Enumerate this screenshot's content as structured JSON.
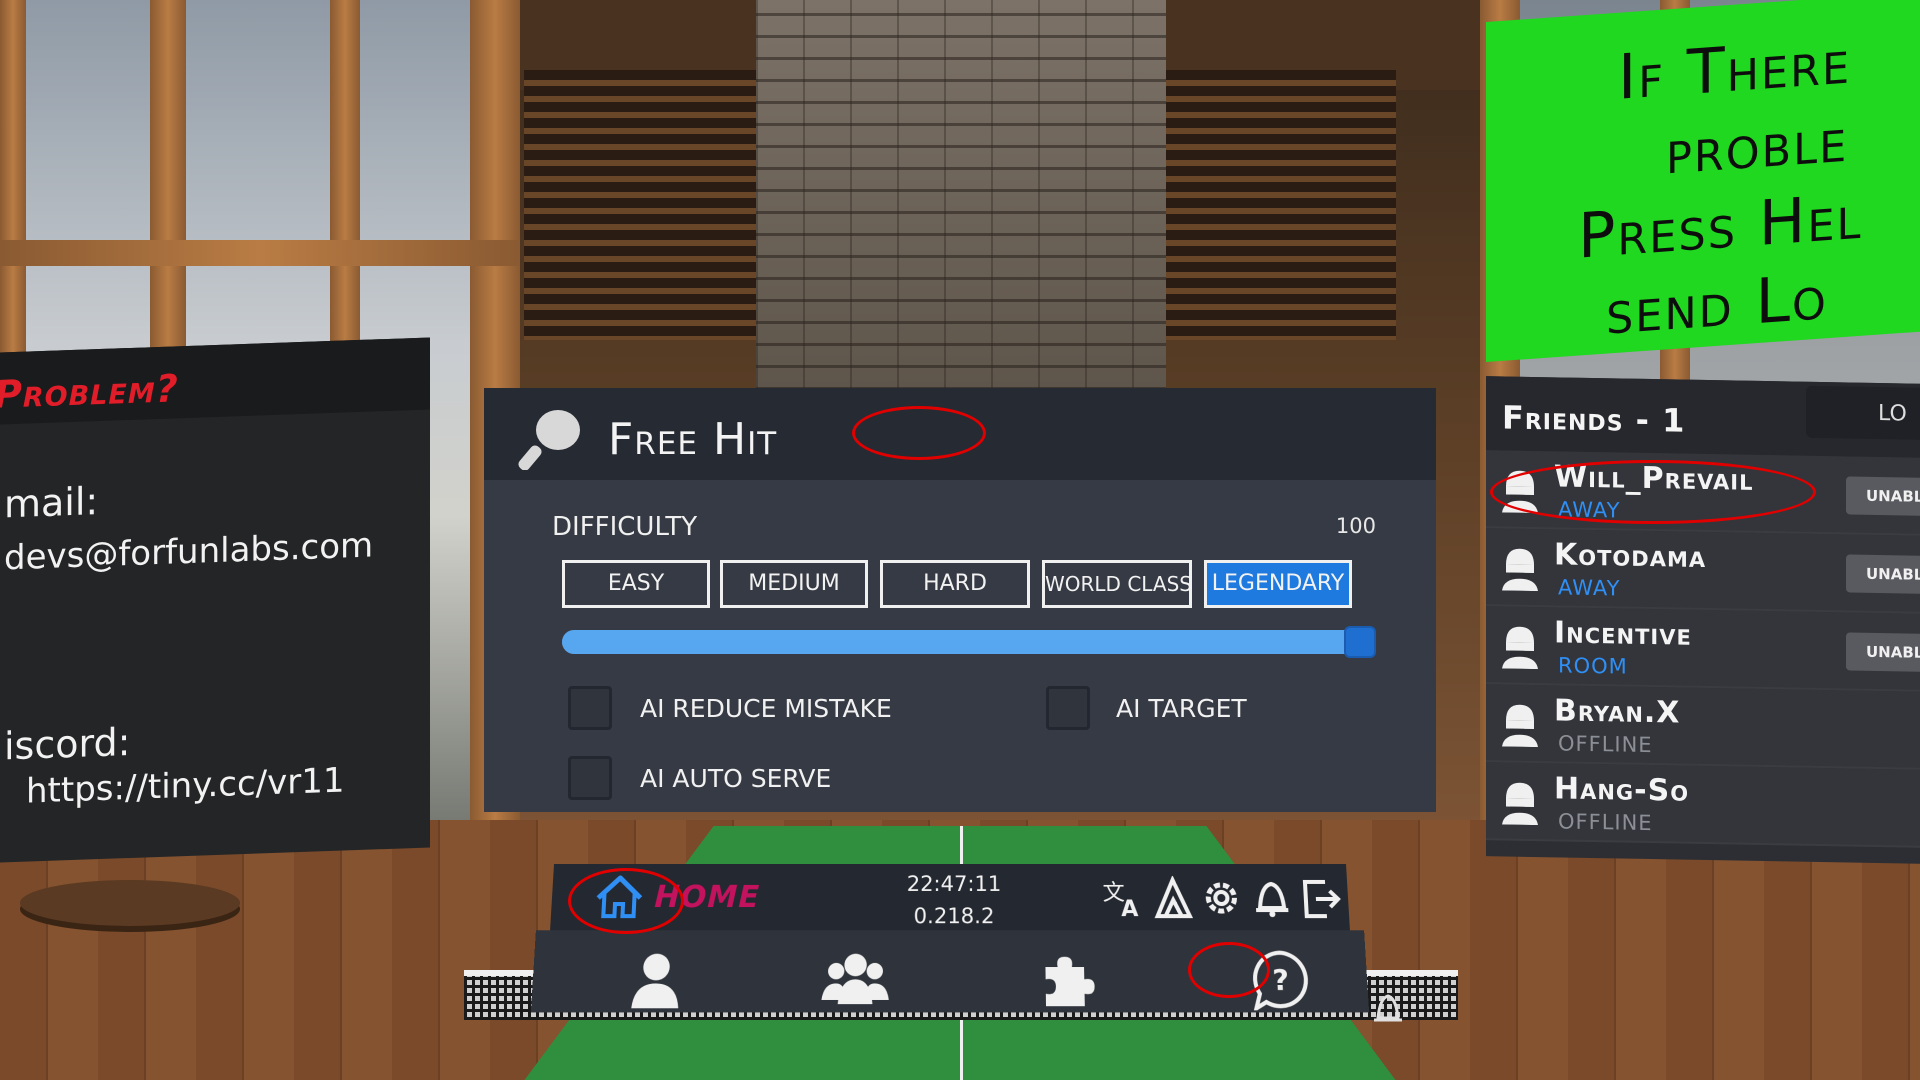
{
  "info_board": {
    "title": "Problem?",
    "email_label": "mail:",
    "email_value": "devs@forfunlabs.com",
    "discord_label": "iscord:",
    "discord_value": "https://tiny.cc/vr11"
  },
  "green_sign": {
    "lines": [
      "If There",
      "proble",
      "Press Hel",
      "send Lo"
    ]
  },
  "friends": {
    "title": "Friends - 1",
    "tab_label": "LO",
    "list": [
      {
        "name": "Will_Prevail",
        "status": "AWAY",
        "status_color": "#2f8ff5",
        "button": "UNABL"
      },
      {
        "name": "Kotodama",
        "status": "AWAY",
        "status_color": "#2f8ff5",
        "button": "UNABL"
      },
      {
        "name": "Incentive",
        "status": "ROOM",
        "status_color": "#2f8ff5",
        "button": "UNABL"
      },
      {
        "name": "Bryan.X",
        "status": "OFFLINE",
        "status_color": "#8c8f96",
        "button": ""
      },
      {
        "name": "Hang-So",
        "status": "OFFLINE",
        "status_color": "#8c8f96",
        "button": ""
      }
    ]
  },
  "panel": {
    "title": "Free Hit",
    "difficulty_label": "DIFFICULTY",
    "difficulty_value": "100",
    "difficulty_level": 1.0,
    "buttons": [
      "EASY",
      "MEDIUM",
      "HARD",
      "WORLD CLASS",
      "LEGENDARY"
    ],
    "active_button": "LEGENDARY",
    "accent": "#1f7ae0",
    "options": [
      {
        "label": "AI REDUCE MISTAKE",
        "checked": false
      },
      {
        "label": "AI TARGET",
        "checked": false
      },
      {
        "label": "AI AUTO SERVE",
        "checked": false
      }
    ]
  },
  "menu": {
    "home_label": "HOME",
    "time": "22:47:11",
    "version": "0.218.2",
    "top_icons": [
      "translate-icon",
      "avatar-mode-icon",
      "gear-icon",
      "notification-bell-icon",
      "exit-icon"
    ],
    "nav_icons": [
      "profile-icon",
      "group-icon",
      "puzzle-icon",
      "help-icon"
    ]
  }
}
